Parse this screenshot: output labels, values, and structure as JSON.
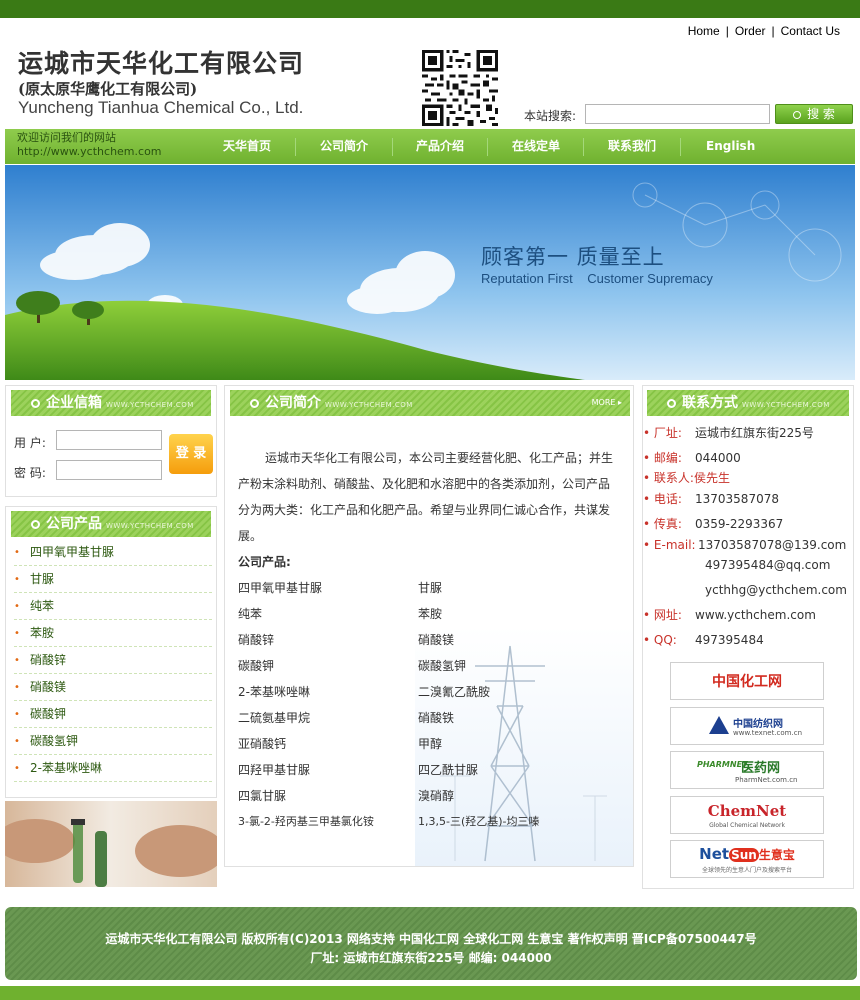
{
  "header": {
    "links": [
      "Home",
      "Order",
      "Contact Us"
    ],
    "logo_cn": "运城市天华化工有限公司",
    "logo_sub": "(原太原华鹰化工有限公司)",
    "logo_en": "Yuncheng Tianhua Chemical Co., Ltd.",
    "search_label": "本站搜索:",
    "search_button": "搜 索"
  },
  "nav": {
    "welcome": "欢迎访问我们的网站",
    "url": "http://www.ycthchem.com",
    "items": [
      "天华首页",
      "公司简介",
      "产品介绍",
      "在线定单",
      "联系我们",
      "English"
    ]
  },
  "banner": {
    "slogan_cn": "顾客第一 质量至上",
    "slogan_en": "Reputation First    Customer Supremacy"
  },
  "login": {
    "title": "企业信箱",
    "watermark": "WWW.YCTHCHEM.COM",
    "user_label": "用 户:",
    "pass_label": "密 码:",
    "button": "登 录"
  },
  "products_box": {
    "title": "公司产品",
    "watermark": "WWW.YCTHCHEM.COM",
    "items": [
      "四甲氧甲基甘脲",
      "甘脲",
      "纯苯",
      "苯胺",
      "硝酸锌",
      "硝酸镁",
      "碳酸钾",
      "碳酸氢钾",
      "2-苯基咪唑啉"
    ]
  },
  "intro": {
    "title": "公司简介",
    "watermark": "WWW.YCTHCHEM.COM",
    "more": "MORE",
    "lines": [
      "运城市天华化工有限公司，本公司主要经营化肥、化工产品；并生",
      "产粉末涂料助剂、硝酸盐、及化肥和水溶肥中的各类添加剂，公司产品",
      "分为两大类：化工产品和化肥产品。希望与业界同仁诚心合作，共谋发",
      "展。"
    ],
    "products_label": "公司产品:",
    "left_col": [
      "四甲氧甲基甘脲",
      "纯苯",
      "硝酸锌",
      "碳酸钾",
      "2-苯基咪唑啉",
      "二硫氨基甲烷",
      "亚硝酸钙",
      "四羟甲基甘脲",
      "四氯甘脲",
      "3-氯-2-羟丙基三甲基氯化铵"
    ],
    "right_col": [
      "甘脲",
      "苯胺",
      "硝酸镁",
      "碳酸氢钾",
      "二溴氰乙酰胺",
      "硝酸铁",
      "甲醇",
      "四乙酰甘脲",
      "溴硝醇",
      "1,3,5-三(羟乙基)-均三嗪"
    ]
  },
  "contact": {
    "title": "联系方式",
    "watermark": "WWW.YCTHCHEM.COM",
    "address_label": "厂址:",
    "address": "运城市红旗东街225号",
    "zip_label": "邮编:",
    "zip": "044000",
    "person_label": "联系人:",
    "person": "侯先生",
    "phone_label": "电话:",
    "phone": "13703587078",
    "fax_label": "传真:",
    "fax": "0359-2293367",
    "email_label": "E-mail:",
    "email1": "13703587078@139.com",
    "email2": "497395484@qq.com",
    "email3": "ycthhg@ycthchem.com",
    "web_label": "网址:",
    "web": "www.ycthchem.com",
    "qq_label": "QQ:",
    "qq": "497395484"
  },
  "partners": {
    "p1": "中国化工网",
    "p2_name": "中国纺织网",
    "p2_url": "www.texnet.com.cn",
    "p3_logo": "PHARMNET",
    "p3_name": "医药网",
    "p3_url": "PharmNet.com.cn",
    "p4_name": "ChemNet",
    "p4_sub": "Global Chemical Network",
    "p5_net": "Net",
    "p5_sun": "Sun",
    "p5_cn": "生意宝",
    "p5_sub": "全球领先的生意人门户及搜索平台"
  },
  "footer": {
    "line1": "运城市天华化工有限公司 版权所有(C)2013 网络支持 中国化工网 全球化工网 生意宝 著作权声明 晋ICP备07500447号",
    "line2": "厂址: 运城市红旗东街225号 邮编: 044000"
  },
  "colors": {
    "accent": "#7dbb3c",
    "dark_green": "#3a7a15",
    "footer": "#62904c",
    "label_red": "#c8322a"
  }
}
